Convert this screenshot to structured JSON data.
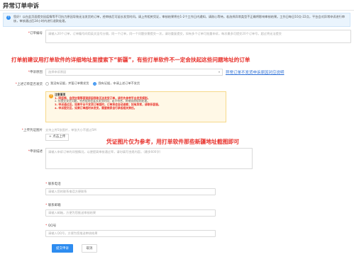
{
  "page": {
    "title": "异常订单申诉"
  },
  "notice": {
    "text": "您好！以在此页面提交因疫情等不可抗力原因导致无法发货的订单，经审核后可延长发货时间。请上传相关凭证，审核结果将在1-2个工作日内通知，请耐心等待。若选择异常类型不正确将影响审核结果。工作日每日10点-22点，平台会对异常申诉进行审核，审核通过后24小时内进行退款处理。"
  },
  "form": {
    "order_no": {
      "label": "订单编号",
      "placeholder": "请输入20个订单，订单编号间用英文逗号分隔，同一个订单，同一个问题仅需提交一次，请勿重复提交，如有多个订单可批量申诉，每次最多可提交20个订单号，超过将无法提交"
    },
    "reason": {
      "label": "申诉原因",
      "placeholder": "选择申诉原因",
      "link": "异常订单不发货申诉原因对应说明"
    },
    "shipped": {
      "label": "上述订单是否发货",
      "options": [
        "我没有证据，并暂订单需发货",
        "我有证据，申请上述订单不发货"
      ]
    },
    "warning": {
      "title": "注意事项",
      "lines": [
        "1. 同疫情、自然灾害等客观原因导致无法发货订单，请优先参考平台发货规则。",
        "2. 仅提交发货问题，符合规则会延长发货时间；若不符合，将按照原规则处理。",
        "3. 申诉通过后，如果平台不发货订单超时，订单将会自动退款；如有异常，请联系客服。",
        "4. 申诉提交后，如果订单超时未发货，需要商家自行承担相关责任。"
      ]
    },
    "upload": {
      "label": "上传凭证图片",
      "hint": "支持上传5张图片，单张大小不超过5M",
      "button": "+ 点击上传"
    },
    "description": {
      "label": "申诉描述",
      "placeholder": "请输入申诉订单的详细情况，以便提高审核通过率，请勿填写违规内容。（最多600字）"
    },
    "contact_phone": {
      "label": "联系电话",
      "placeholder": "请输入您的联系电话方便联系"
    },
    "contact_email": {
      "label": "联系邮箱",
      "placeholder": "请输入邮箱，方便为您推送审核结果"
    },
    "qq": {
      "label": "QQ号",
      "placeholder": "请输入QQ号，方便为您推送审核结果"
    },
    "submit": "提交申诉",
    "cancel": "取消"
  },
  "annotations": {
    "top": "打单前建议用打单软件的详细地址里搜索下“新疆”，有些打单软件不一定会扶起这些问题地址的订单",
    "middle": "凭证图片仅为参考，用打单软件那些新疆地址截图即可"
  },
  "colors": {
    "primary": "#2d8cf0",
    "annotation_red": "#e8302a",
    "link_blue": "#2d6fd6",
    "notice_bg": "#eaf4fd",
    "warning_bg": "#fff8e6"
  }
}
